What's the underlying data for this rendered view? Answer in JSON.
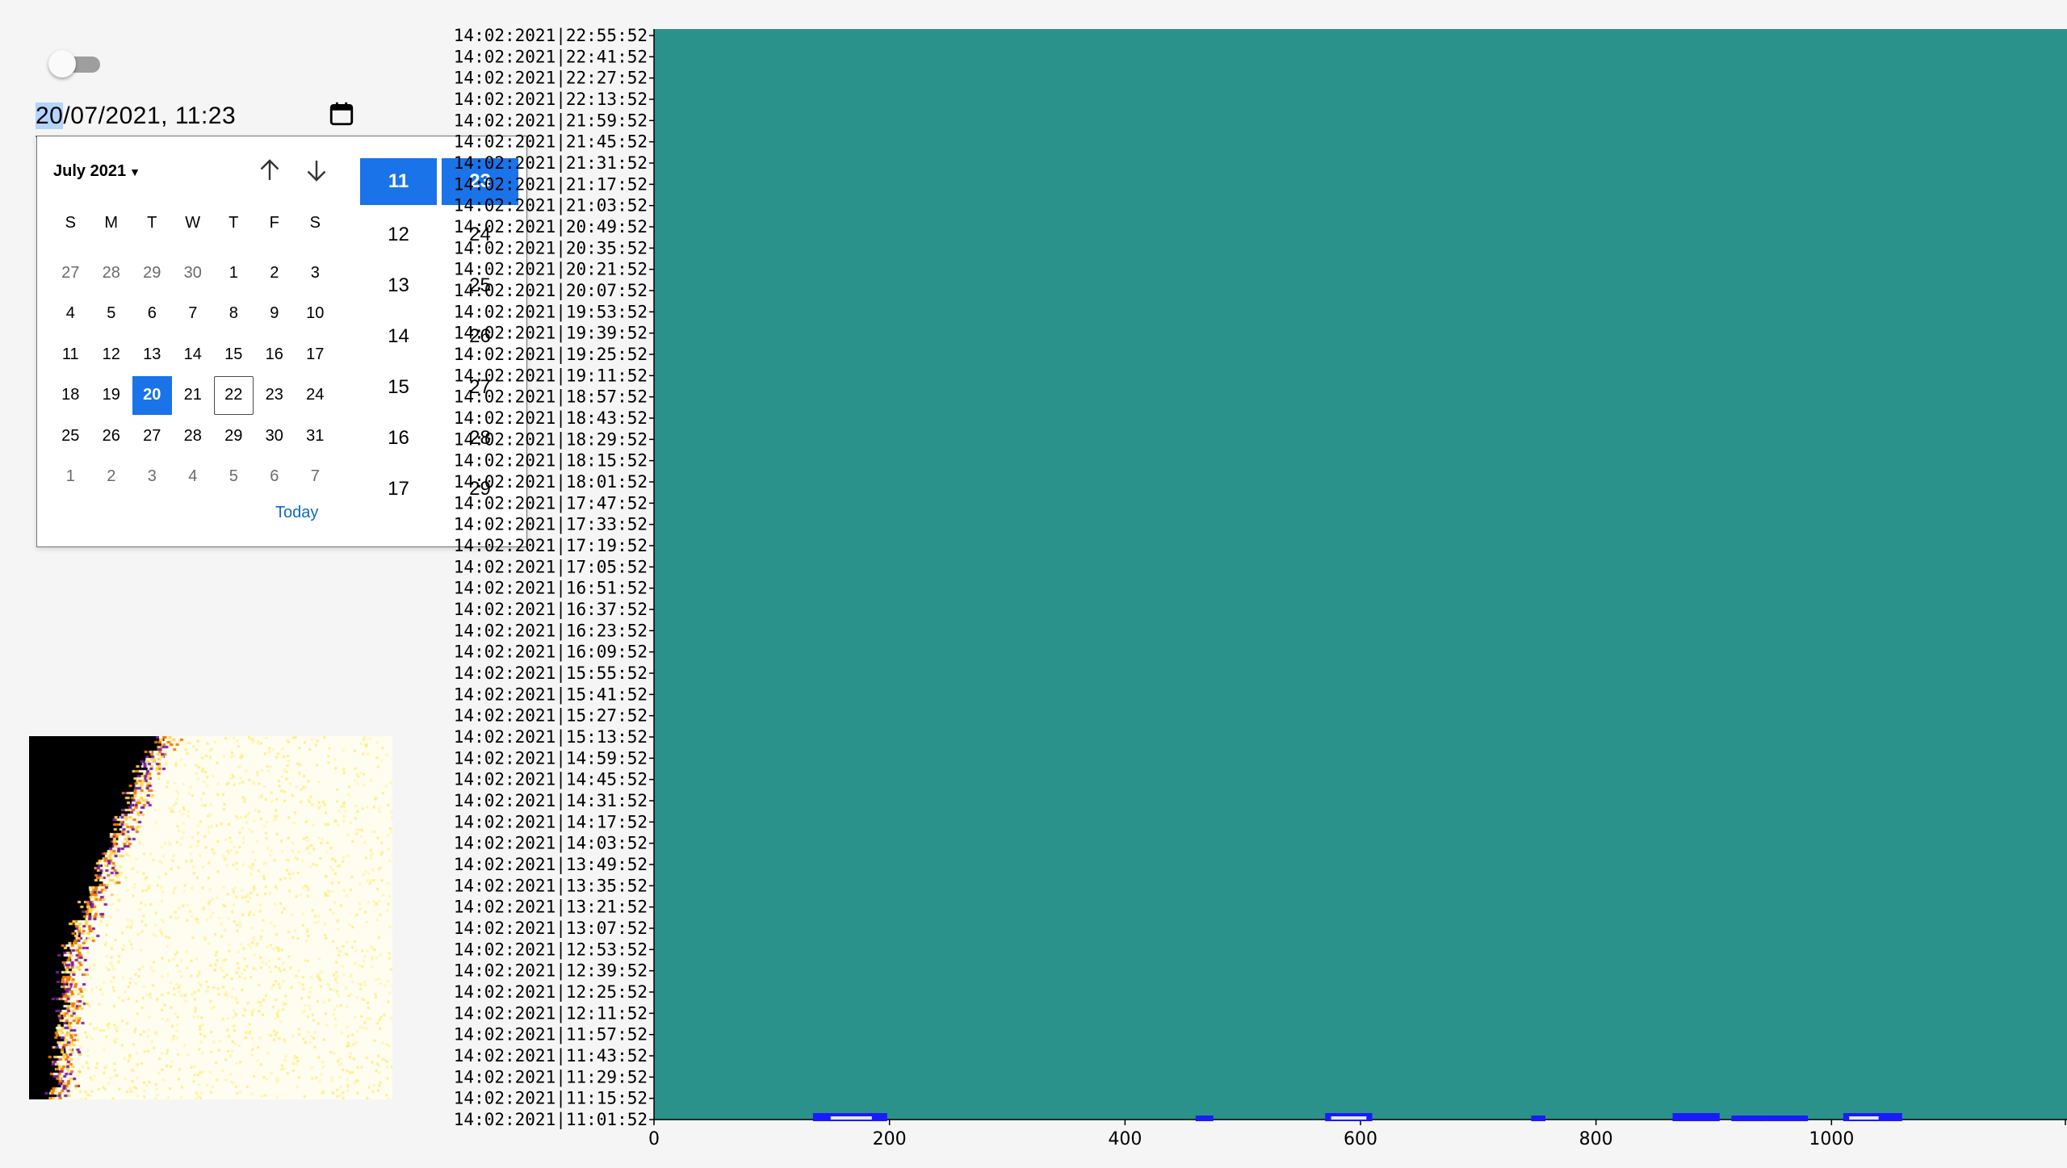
{
  "toggle": {
    "state": "off"
  },
  "datetime": {
    "day_part": "20",
    "rest": "/07/2021, 11:23",
    "calendar_icon": "calendar-icon"
  },
  "picker": {
    "month_label": "July 2021",
    "nav_up_icon": "arrow-up-icon",
    "nav_down_icon": "arrow-down-icon",
    "weekdays": [
      "S",
      "M",
      "T",
      "W",
      "T",
      "F",
      "S"
    ],
    "days": [
      {
        "d": "27",
        "m": "prev"
      },
      {
        "d": "28",
        "m": "prev"
      },
      {
        "d": "29",
        "m": "prev"
      },
      {
        "d": "30",
        "m": "prev"
      },
      {
        "d": "1",
        "m": "cur"
      },
      {
        "d": "2",
        "m": "cur"
      },
      {
        "d": "3",
        "m": "cur"
      },
      {
        "d": "4",
        "m": "cur"
      },
      {
        "d": "5",
        "m": "cur"
      },
      {
        "d": "6",
        "m": "cur"
      },
      {
        "d": "7",
        "m": "cur"
      },
      {
        "d": "8",
        "m": "cur"
      },
      {
        "d": "9",
        "m": "cur"
      },
      {
        "d": "10",
        "m": "cur"
      },
      {
        "d": "11",
        "m": "cur"
      },
      {
        "d": "12",
        "m": "cur"
      },
      {
        "d": "13",
        "m": "cur"
      },
      {
        "d": "14",
        "m": "cur"
      },
      {
        "d": "15",
        "m": "cur"
      },
      {
        "d": "16",
        "m": "cur"
      },
      {
        "d": "17",
        "m": "cur"
      },
      {
        "d": "18",
        "m": "cur"
      },
      {
        "d": "19",
        "m": "cur"
      },
      {
        "d": "20",
        "m": "cur",
        "selected": true
      },
      {
        "d": "21",
        "m": "cur"
      },
      {
        "d": "22",
        "m": "cur",
        "today": true
      },
      {
        "d": "23",
        "m": "cur"
      },
      {
        "d": "24",
        "m": "cur"
      },
      {
        "d": "25",
        "m": "cur"
      },
      {
        "d": "26",
        "m": "cur"
      },
      {
        "d": "27",
        "m": "cur"
      },
      {
        "d": "28",
        "m": "cur"
      },
      {
        "d": "29",
        "m": "cur"
      },
      {
        "d": "30",
        "m": "cur"
      },
      {
        "d": "31",
        "m": "cur"
      },
      {
        "d": "1",
        "m": "next"
      },
      {
        "d": "2",
        "m": "next"
      },
      {
        "d": "3",
        "m": "next"
      },
      {
        "d": "4",
        "m": "next"
      },
      {
        "d": "5",
        "m": "next"
      },
      {
        "d": "6",
        "m": "next"
      },
      {
        "d": "7",
        "m": "next"
      }
    ],
    "today_label": "Today",
    "hours": [
      "11",
      "12",
      "13",
      "14",
      "15",
      "16",
      "17"
    ],
    "minutes": [
      "23",
      "24",
      "25",
      "26",
      "27",
      "28",
      "29"
    ],
    "selected_hour": "11",
    "selected_minute": "23"
  },
  "colors": {
    "accent": "#1a73e8",
    "plot_background": "#2a928a",
    "marker_blue": "#1a1aff",
    "marker_white": "#e8e8e8"
  },
  "chart_data": {
    "type": "heatmap",
    "background_color": "#2a928a",
    "x_ticks": [
      "0",
      "200",
      "400",
      "600",
      "800",
      "1000"
    ],
    "x_range": [
      0,
      1200
    ],
    "y_tick_labels": [
      "14:02:2021|22:55:52",
      "14:02:2021|22:41:52",
      "14:02:2021|22:27:52",
      "14:02:2021|22:13:52",
      "14:02:2021|21:59:52",
      "14:02:2021|21:45:52",
      "14:02:2021|21:31:52",
      "14:02:2021|21:17:52",
      "14:02:2021|21:03:52",
      "14:02:2021|20:49:52",
      "14:02:2021|20:35:52",
      "14:02:2021|20:21:52",
      "14:02:2021|20:07:52",
      "14:02:2021|19:53:52",
      "14:02:2021|19:39:52",
      "14:02:2021|19:25:52",
      "14:02:2021|19:11:52",
      "14:02:2021|18:57:52",
      "14:02:2021|18:43:52",
      "14:02:2021|18:29:52",
      "14:02:2021|18:15:52",
      "14:02:2021|18:01:52",
      "14:02:2021|17:47:52",
      "14:02:2021|17:33:52",
      "14:02:2021|17:19:52",
      "14:02:2021|17:05:52",
      "14:02:2021|16:51:52",
      "14:02:2021|16:37:52",
      "14:02:2021|16:23:52",
      "14:02:2021|16:09:52",
      "14:02:2021|15:55:52",
      "14:02:2021|15:41:52",
      "14:02:2021|15:27:52",
      "14:02:2021|15:13:52",
      "14:02:2021|14:59:52",
      "14:02:2021|14:45:52",
      "14:02:2021|14:31:52",
      "14:02:2021|14:17:52",
      "14:02:2021|14:03:52",
      "14:02:2021|13:49:52",
      "14:02:2021|13:35:52",
      "14:02:2021|13:21:52",
      "14:02:2021|13:07:52",
      "14:02:2021|12:53:52",
      "14:02:2021|12:39:52",
      "14:02:2021|12:25:52",
      "14:02:2021|12:11:52",
      "14:02:2021|11:57:52",
      "14:02:2021|11:43:52",
      "14:02:2021|11:29:52",
      "14:02:2021|11:15:52",
      "14:02:2021|11:01:52"
    ],
    "markers": [
      {
        "x0": 135,
        "x1": 198,
        "color": "#1a1aff",
        "row": "14:02:2021|11:01:52"
      },
      {
        "x0": 150,
        "x1": 185,
        "color": "#e8e8e8",
        "row": "14:02:2021|11:01:52"
      },
      {
        "x0": 460,
        "x1": 475,
        "color": "#1a1aff",
        "row": "14:02:2021|11:01:52"
      },
      {
        "x0": 570,
        "x1": 610,
        "color": "#1a1aff",
        "row": "14:02:2021|11:01:52"
      },
      {
        "x0": 575,
        "x1": 605,
        "color": "#e8e8e8",
        "row": "14:02:2021|11:01:52"
      },
      {
        "x0": 745,
        "x1": 757,
        "color": "#1a1aff",
        "row": "14:02:2021|11:01:52"
      },
      {
        "x0": 865,
        "x1": 905,
        "color": "#1a1aff",
        "row": "14:02:2021|11:01:52"
      },
      {
        "x0": 915,
        "x1": 945,
        "color": "#1a1aff",
        "row": "14:02:2021|11:01:52"
      },
      {
        "x0": 945,
        "x1": 980,
        "color": "#1a1aff",
        "row": "14:02:2021|11:01:52"
      },
      {
        "x0": 1010,
        "x1": 1060,
        "color": "#1a1aff",
        "row": "14:02:2021|11:01:52"
      },
      {
        "x0": 1015,
        "x1": 1040,
        "color": "#e8e8e8",
        "row": "14:02:2021|11:01:52"
      }
    ]
  }
}
